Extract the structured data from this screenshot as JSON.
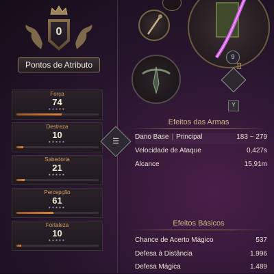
{
  "attribute_points": {
    "value": "0",
    "label": "Pontos de Atributo"
  },
  "stats": [
    {
      "label": "Força",
      "value": "74",
      "dots_filled": 3,
      "dots_total": 5,
      "fill": 0.55
    },
    {
      "label": "Destreza",
      "value": "10",
      "dots_filled": 0,
      "dots_total": 5,
      "fill": 0.08
    },
    {
      "label": "Sabedoria",
      "value": "21",
      "dots_filled": 0,
      "dots_total": 5,
      "fill": 0.1
    },
    {
      "label": "Percepção",
      "value": "61",
      "dots_filled": 2,
      "dots_total": 5,
      "fill": 0.45
    },
    {
      "label": "Fortaleza",
      "value": "10",
      "dots_filled": 0,
      "dots_total": 5,
      "fill": 0.06
    }
  ],
  "equipment": {
    "weapon_level_badge": "9",
    "rune_glyph": "Ⅱ",
    "slot_tag": "Y"
  },
  "weapon_effects": {
    "title": "Efeitos das Armas",
    "rows": [
      {
        "label": "Dano Base",
        "sublabel": "Principal",
        "value": "183 ~ 279"
      },
      {
        "label": "Velocidade de Ataque",
        "value": "0,427s"
      },
      {
        "label": "Alcance",
        "value": "15,91m"
      }
    ]
  },
  "basic_effects": {
    "title": "Efeitos Básicos",
    "rows": [
      {
        "label": "Chance de Acerto Mágico",
        "value": "537"
      },
      {
        "label": "Defesa à Distância",
        "value": "1.996"
      },
      {
        "label": "Defesa Mágica",
        "value": "1.489"
      }
    ]
  },
  "colors": {
    "accent_orange": "#d9853e",
    "dot_active": "#b779e0",
    "gold_text": "#d4b78a"
  },
  "icons": [
    "crown-icon",
    "shield-icon",
    "griffin-icon",
    "staff-icon",
    "bow-icon",
    "arrow-right-icon"
  ]
}
